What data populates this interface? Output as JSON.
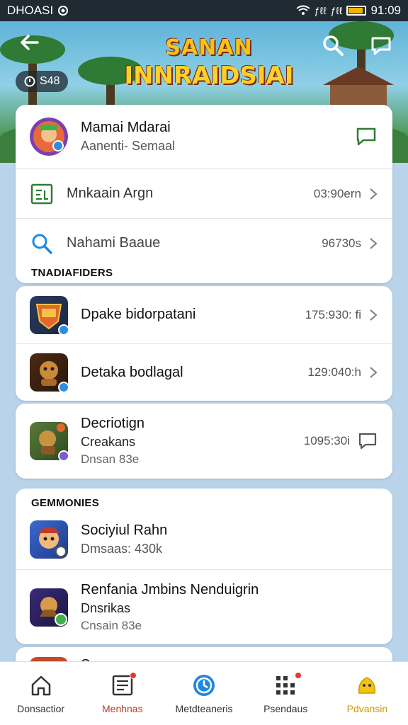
{
  "status_bar": {
    "carrier": "DHOASI",
    "signal_text": "ƒℓℓ",
    "network_text": "ƒℓℓ",
    "time": "91:09"
  },
  "header": {
    "title_line1": "SANAN",
    "title_line2": "INNRAIDSIAI",
    "badge": "S48"
  },
  "profile": {
    "name": "Mamai Mdarai",
    "subtitle": "Aanenti- Semaal"
  },
  "menu_rows": [
    {
      "label": "Mnkaain Argn",
      "meta": "03:90ern"
    },
    {
      "label": "Nahami Baaue",
      "meta": "96730s"
    }
  ],
  "section1": "TNADIAFIDERS",
  "list1": [
    {
      "title": "Dpake bidorpatani",
      "meta": "175:930: fi"
    },
    {
      "title": "Detaka bodlagal",
      "meta": "129:040:h"
    }
  ],
  "card3": {
    "title": "Decriotign",
    "line2": "Creakans",
    "line3": "Dnsan 83e",
    "meta": "1095:30i"
  },
  "section2": "GEMMONIES",
  "list2": [
    {
      "title": "Sociyiul Rahn",
      "line2": "Dmsaas: 430k"
    },
    {
      "title": "Renfania Jmbins Nenduigrin",
      "line2": "Dnsrikas",
      "line3": "Cnsain 83e"
    }
  ],
  "partial_row_title": "S",
  "bottom_nav": [
    {
      "label": "Donsactior"
    },
    {
      "label": "Menhnas"
    },
    {
      "label": "Metdteaneris"
    },
    {
      "label": "Psendaus"
    },
    {
      "label": "Pdvansin"
    }
  ],
  "colors": {
    "accent_green": "#2e7d32",
    "accent_blue": "#1e88e5",
    "notification_red": "#e53935",
    "gold": "#f2b400"
  }
}
